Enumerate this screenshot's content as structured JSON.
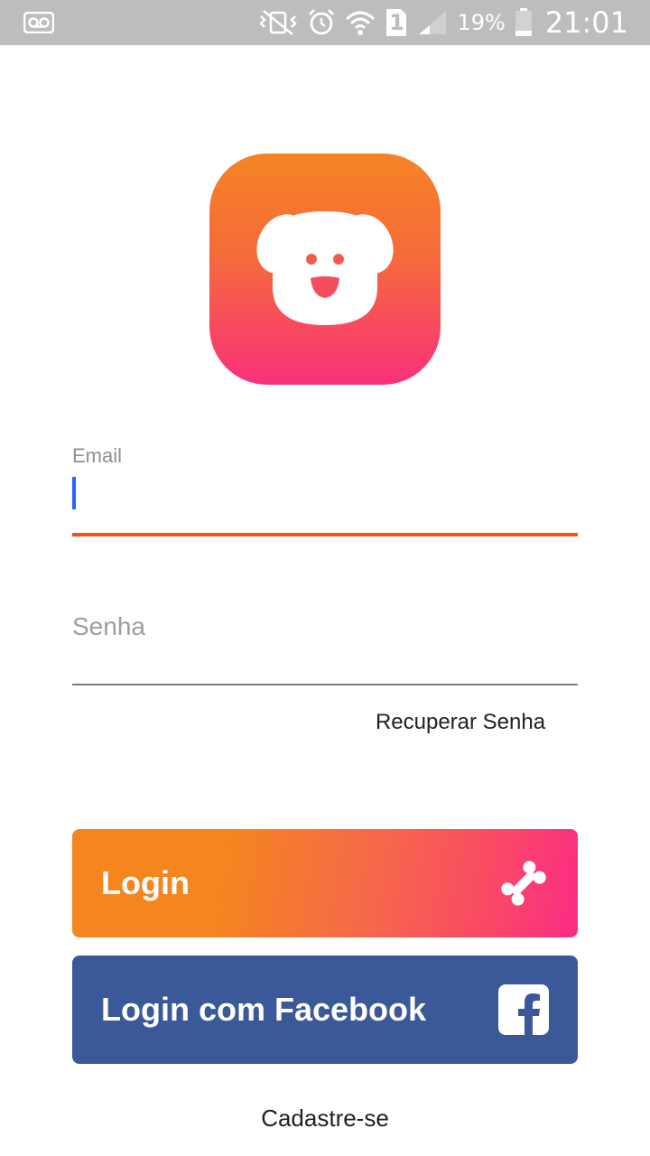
{
  "status_bar": {
    "battery_percent": "19%",
    "time": "21:01",
    "sim_slot": "1",
    "icons": [
      "voicemail-icon",
      "vibrate-mute-icon",
      "alarm-icon",
      "wifi-icon",
      "sim-1-icon",
      "signal-icon",
      "battery-icon"
    ]
  },
  "logo": {
    "icon": "dog-face-icon",
    "gradient": [
      "#f58424",
      "#f8307b"
    ]
  },
  "email_field": {
    "label": "Email",
    "value": ""
  },
  "password_field": {
    "placeholder": "Senha",
    "value": ""
  },
  "forgot_password": {
    "label": "Recuperar Senha"
  },
  "login_button": {
    "label": "Login",
    "icon": "bone-icon"
  },
  "facebook_button": {
    "label": "Login com Facebook",
    "icon": "facebook-icon"
  },
  "signup_link": {
    "label": "Cadastre-se"
  },
  "colors": {
    "accent_orange": "#f5851f",
    "accent_pink": "#fb2c84",
    "focus_underline": "#f4511e",
    "caret": "#2962ff",
    "facebook_blue": "#3b5998",
    "status_bar": "#bdbdbd"
  }
}
